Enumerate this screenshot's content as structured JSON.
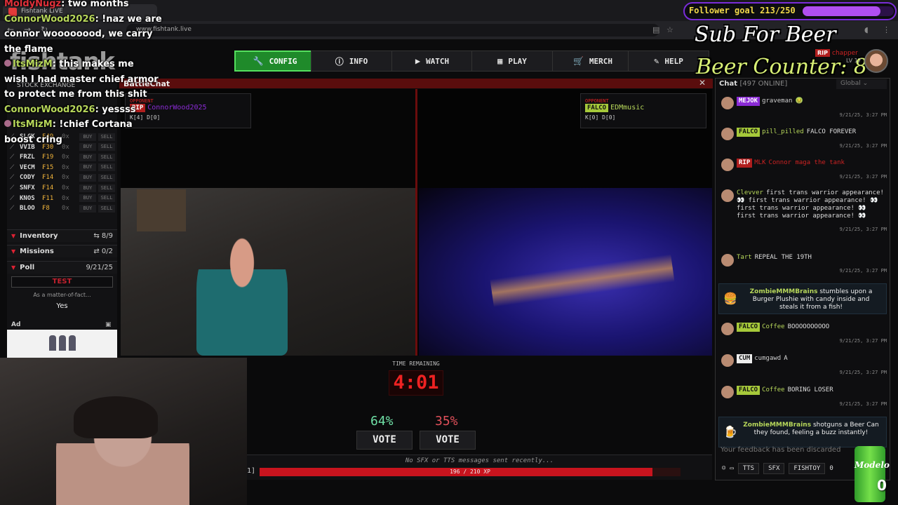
{
  "browser": {
    "tab_title": "Fishtank LIVE",
    "url": "www.fishtank.live"
  },
  "site": {
    "logo": "fishtank"
  },
  "nav": [
    {
      "label": "CONFIG",
      "icon": "wrench-icon",
      "active": true
    },
    {
      "label": "INFO",
      "icon": "info-icon",
      "active": false
    },
    {
      "label": "WATCH",
      "icon": "camera-icon",
      "active": false
    },
    {
      "label": "PLAY",
      "icon": "grid-icon",
      "active": false
    },
    {
      "label": "MERCH",
      "icon": "cart-icon",
      "active": false
    },
    {
      "label": "HELP",
      "icon": "help-icon",
      "active": false
    }
  ],
  "battlechat": {
    "label": "BattleChat"
  },
  "sidebar": {
    "stocks_header": "STOCK EXCHANGE",
    "stocks": [
      {
        "sym": "SLCK",
        "price": "₣49"
      },
      {
        "sym": "VVIB",
        "price": "₣30"
      },
      {
        "sym": "FRZL",
        "price": "₣19"
      },
      {
        "sym": "VECM",
        "price": "₣15"
      },
      {
        "sym": "CODY",
        "price": "₣14"
      },
      {
        "sym": "SNFX",
        "price": "₣14"
      },
      {
        "sym": "KNOS",
        "price": "₣11"
      },
      {
        "sym": "BLOO",
        "price": "₣8"
      }
    ],
    "owned": "0x",
    "buy_label": "BUY",
    "sell_label": "SELL",
    "inventory": {
      "label": "Inventory",
      "count": "8/9"
    },
    "missions": {
      "label": "Missions",
      "count": "0/2"
    },
    "poll": {
      "label": "Poll",
      "date": "9/21/25",
      "title": "TEST",
      "subtitle": "As a matter-of-fact...",
      "answer": "Yes"
    },
    "ad_label": "Ad"
  },
  "battle": {
    "left": {
      "opp_label": "OPPONENT",
      "badge": "RIP",
      "name": "ConnorWood2025",
      "kd": "K[4] D[0]"
    },
    "right": {
      "opp_label": "OPPONENT",
      "badge": "FALCO",
      "name": "EDMmusic",
      "kd": "K[0] D[0]"
    },
    "time_label": "TIME REMAINING",
    "timer": "4:01",
    "left_pct": "64%",
    "right_pct": "35%",
    "vote_label": "VOTE",
    "left_color": "#6fe0a6",
    "right_color": "#e0505a"
  },
  "footer": {
    "sfx_message": "No SFX or TTS messages sent recently...",
    "xp_text": "196 / 210 XP",
    "xp_fraction": 0.933,
    "level_bracket": "1]"
  },
  "overlay_chat": [
    {
      "user": "MoldyNugz",
      "text": "two months",
      "red": true
    },
    {
      "user": "ConnorWood2026",
      "text": "!naz we are",
      "red": false
    },
    {
      "user": "",
      "text": "connor woooooood, we carry",
      "red": false
    },
    {
      "user": "",
      "text": "the flame",
      "red": false
    },
    {
      "user": "ItsMizM",
      "text": "this makes me",
      "red": false,
      "bullet": true
    },
    {
      "user": "",
      "text": "wish I had master chief armor",
      "red": false
    },
    {
      "user": "",
      "text": "to protect me from this shit",
      "red": false
    },
    {
      "user": "ConnorWood2026",
      "text": "yessss",
      "red": false
    },
    {
      "user": "ItsMizM",
      "text": "!chief Cortana",
      "red": false,
      "bullet": true
    },
    {
      "user": "",
      "text": "boost cring",
      "red": false
    }
  ],
  "stream": {
    "follower_goal": "Follower goal 213/250",
    "follower_fraction": 0.852,
    "beer_title": "Sub For Beer",
    "beer_counter": "Beer Counter: 8",
    "can_label": "Modelo",
    "can_count": "0",
    "profile_badge": "RIP",
    "profile_name": "chapper",
    "profile_level": "LV 17"
  },
  "chat": {
    "title": "Chat",
    "online": "[497 ONLINE]",
    "scope": "Global",
    "messages": [
      {
        "badge": "MEJOK",
        "badge_type": "mejok",
        "user": "graveman",
        "text": "🤢",
        "time": "9/21/25, 3:27 PM"
      },
      {
        "badge": "FALCO",
        "badge_type": "falco",
        "user": "pill_pilled",
        "text": "FALCO FOREVER",
        "time": "9/21/25, 3:27 PM"
      },
      {
        "badge": "RIP",
        "badge_type": "rip",
        "user": "MLK",
        "text": "Connor maga the tank",
        "time": "9/21/25, 3:27 PM",
        "strike": true
      },
      {
        "badge": "",
        "badge_type": "",
        "user": "Clevver",
        "text": "first trans warrior appearance! 👀 first trans warrior appearance! 👀 first trans warrior appearance! 👀 first trans warrior appearance! 👀",
        "time": "9/21/25, 3:27 PM"
      },
      {
        "badge": "",
        "badge_type": "",
        "user": "Tart",
        "text": "REPEAL THE 19TH",
        "time": "9/21/25, 3:27 PM"
      },
      {
        "badge": "FALCO",
        "badge_type": "falco",
        "user": "Coffee",
        "text": "BOOOOOOOOOO",
        "time": "9/21/25, 3:27 PM"
      },
      {
        "badge": "CUM",
        "badge_type": "cum",
        "user": "cumgawd",
        "text": "A",
        "time": "9/21/25, 3:27 PM"
      },
      {
        "badge": "FALCO",
        "badge_type": "falco",
        "user": "Coffee",
        "text": "BORING LOSER",
        "time": "9/21/25, 3:27 PM"
      }
    ],
    "events": [
      {
        "user": "ZombieMMMBrains",
        "text": "stumbles upon a Burger Plushie with candy inside and steals it from a fish!"
      },
      {
        "user": "ZombieMMMBrains",
        "text": "shotguns a Beer Can they found, feeling a buzz instantly!"
      }
    ],
    "feedback": "Your feedback has been discarded",
    "toolbar": [
      "TTS",
      "SFX",
      "FISHTOY"
    ],
    "toolbar_count": "0"
  }
}
